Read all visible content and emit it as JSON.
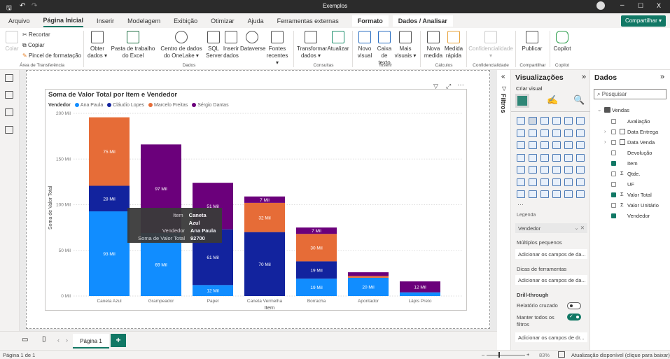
{
  "window": {
    "title": "Exemplos"
  },
  "menu_tabs": [
    {
      "label": "Arquivo"
    },
    {
      "label": "Página Inicial"
    },
    {
      "label": "Inserir"
    },
    {
      "label": "Modelagem"
    },
    {
      "label": "Exibição"
    },
    {
      "label": "Otimizar"
    },
    {
      "label": "Ajuda"
    },
    {
      "label": "Ferramentas externas"
    },
    {
      "label": "Formato"
    },
    {
      "label": "Dados / Analisar"
    }
  ],
  "share_label": "Compartilhar",
  "ribbon": {
    "paste": "Colar",
    "cut": "Recortar",
    "copy": "Copiar",
    "format_painter": "Pincel de formatação",
    "group_clipboard": "Área de Transferência",
    "buttons": [
      {
        "label": "Obter dados ▾"
      },
      {
        "label": "Pasta de trabalho do Excel"
      },
      {
        "label": "Centro de dados do OneLake ▾"
      },
      {
        "label": "SQL Server"
      },
      {
        "label": "Inserir dados"
      },
      {
        "label": "Dataverse"
      },
      {
        "label": "Fontes recentes ▾"
      },
      {
        "label": "Transformar dados ▾"
      },
      {
        "label": "Atualizar"
      },
      {
        "label": "Novo visual"
      },
      {
        "label": "Caixa de texto"
      },
      {
        "label": "Mais visuais ▾"
      },
      {
        "label": "Nova medida"
      },
      {
        "label": "Medida rápida"
      },
      {
        "label": "Confidencialidade ▾"
      },
      {
        "label": "Publicar"
      },
      {
        "label": "Copilot"
      }
    ],
    "groups": [
      "Dados",
      "Consultas",
      "Inserir",
      "Cálculos",
      "Confidencialidade",
      "Compartilhar",
      "Copilot"
    ]
  },
  "tooltip": {
    "rows": [
      {
        "key": "Item",
        "value": "Caneta Azul"
      },
      {
        "key": "Vendedor",
        "value": "Ana Paula"
      },
      {
        "key": "Soma de Valor Total",
        "value": "92700"
      }
    ]
  },
  "chart_data": {
    "type": "bar",
    "stacked": true,
    "title": "Soma de Valor Total por Item e Vendedor",
    "legend_title": "Vendedor",
    "legend_position": "top-left",
    "xlabel": "Item",
    "ylabel": "Soma de Valor Total",
    "ylim": [
      0,
      200
    ],
    "yticks": [
      "0 Mil",
      "50 Mil",
      "100 Mil",
      "150 Mil",
      "200 Mil"
    ],
    "grid": true,
    "categories": [
      "Caneta Azul",
      "Grampeador",
      "Papel",
      "Caneta Vermelha",
      "Borracha",
      "Apontador",
      "Lápis Preto"
    ],
    "series": [
      {
        "name": "Ana Paula",
        "color": "#118DFF",
        "values": [
          92.7,
          69,
          12,
          0,
          19,
          20,
          4
        ]
      },
      {
        "name": "Cláudio Lopes",
        "color": "#12239E",
        "values": [
          28,
          0,
          61,
          70,
          19,
          0,
          0
        ]
      },
      {
        "name": "Marcelo Freitas",
        "color": "#E66C37",
        "values": [
          75,
          0,
          0,
          32,
          30,
          2,
          0
        ]
      },
      {
        "name": "Sérgio Dantas",
        "color": "#6B007B",
        "values": [
          0,
          97,
          51,
          7,
          7,
          4,
          12
        ]
      }
    ]
  },
  "page_tabs": {
    "current": "Página 1",
    "add": "+"
  },
  "status": {
    "page": "Página 1 de 1",
    "zoom": "83%",
    "update": "Atualização disponível (clique para baixar)"
  },
  "filters": {
    "label": "Filtros"
  },
  "visualizations": {
    "title": "Visualizações",
    "build_label": "Criar visual",
    "legend_section": "Legenda",
    "legend_field": "Vendedor",
    "small_multiples": "Múltiplos pequenos",
    "small_multiples_placeholder": "Adicionar os campos de da...",
    "tooltips": "Dicas de ferramentas",
    "tooltips_placeholder": "Adicionar os campos de da...",
    "drillthrough": "Drill-through",
    "cross_report": "Relatório cruzado",
    "cross_report_on": false,
    "keep_filters": "Manter todos os filtros",
    "keep_filters_on": true,
    "drillthrough_placeholder": "Adicionar os campos de dr...",
    "more": "···"
  },
  "data_pane": {
    "title": "Dados",
    "search_placeholder": "Pesquisar",
    "table": "Vendas",
    "fields": [
      {
        "name": "Avaliação",
        "checked": false,
        "sigma": false,
        "expandable": false
      },
      {
        "name": "Data Entrega",
        "checked": false,
        "sigma": false,
        "expandable": true
      },
      {
        "name": "Data Venda",
        "checked": false,
        "sigma": false,
        "expandable": true
      },
      {
        "name": "Devolução",
        "checked": false,
        "sigma": false,
        "expandable": false
      },
      {
        "name": "Item",
        "checked": true,
        "sigma": false,
        "expandable": false
      },
      {
        "name": "Qtde.",
        "checked": false,
        "sigma": true,
        "expandable": false
      },
      {
        "name": "UF",
        "checked": false,
        "sigma": false,
        "expandable": false
      },
      {
        "name": "Valor Total",
        "checked": true,
        "sigma": true,
        "expandable": false
      },
      {
        "name": "Valor Unitário",
        "checked": false,
        "sigma": true,
        "expandable": false
      },
      {
        "name": "Vendedor",
        "checked": true,
        "sigma": false,
        "expandable": false
      }
    ]
  }
}
